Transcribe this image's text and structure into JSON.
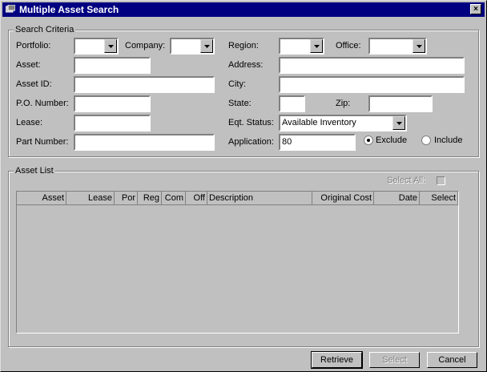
{
  "window": {
    "title": "Multiple Asset Search",
    "close_glyph": "×"
  },
  "criteria": {
    "legend": "Search Criteria",
    "portfolio_label": "Portfolio:",
    "company_label": "Company:",
    "region_label": "Region:",
    "office_label": "Office:",
    "asset_label": "Asset:",
    "address_label": "Address:",
    "asset_id_label": "Asset ID:",
    "city_label": "City:",
    "po_number_label": "P.O. Number:",
    "state_label": "State:",
    "zip_label": "Zip:",
    "lease_label": "Lease:",
    "eqt_status_label": "Eqt. Status:",
    "eqt_status_value": "Available Inventory",
    "part_number_label": "Part Number:",
    "application_label": "Application:",
    "application_value": "80",
    "exclude_label": "Exclude",
    "include_label": "Include",
    "selected_mode": "exclude"
  },
  "asset_list": {
    "legend": "Asset List",
    "select_all_label": "Select All:",
    "columns": [
      "Asset",
      "Lease",
      "Por",
      "Reg",
      "Com",
      "Off",
      "Description",
      "Original Cost",
      "Date",
      "Select"
    ]
  },
  "buttons": {
    "retrieve": "Retrieve",
    "select": "Select",
    "cancel": "Cancel"
  }
}
